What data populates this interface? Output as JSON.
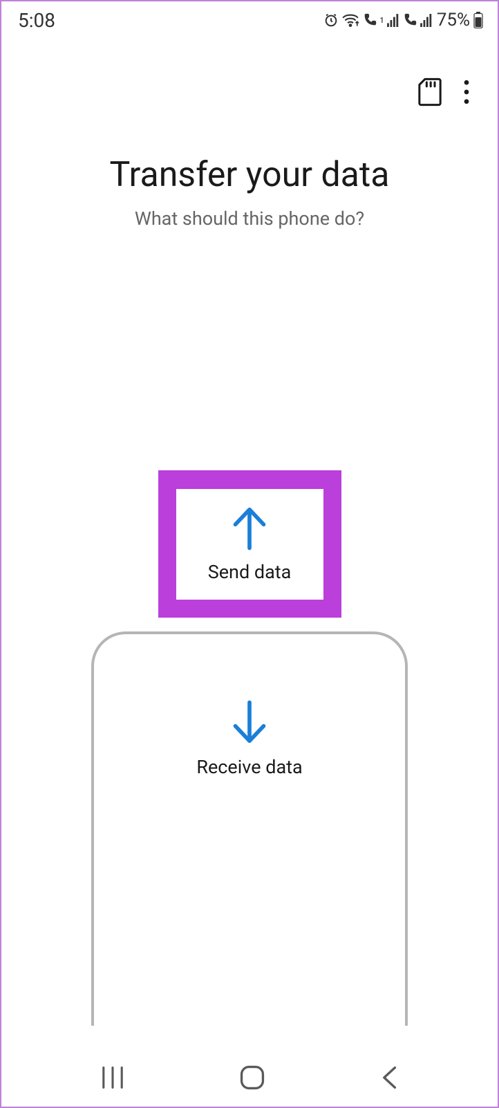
{
  "status": {
    "time": "5:08",
    "battery_pct": "75%"
  },
  "header": {
    "title": "Transfer your data",
    "subtitle": "What should this phone do?"
  },
  "options": {
    "send_label": "Send data",
    "receive_label": "Receive data"
  },
  "colors": {
    "highlight": "#bb3fdb",
    "accent": "#1a7fd8"
  }
}
